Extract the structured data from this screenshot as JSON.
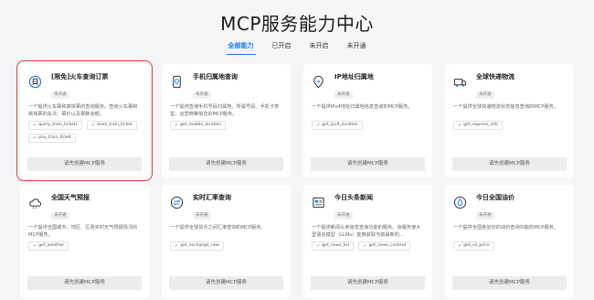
{
  "page": {
    "title": "MCP服务能力中心"
  },
  "tabs": [
    {
      "label": "全部能力",
      "active": true
    },
    {
      "label": "已开启"
    },
    {
      "label": "未开启"
    },
    {
      "label": "未开通"
    }
  ],
  "cards": [
    {
      "name": "[限免]火车查询订票",
      "status": "未开通",
      "desc": "一个提供火车票和高铁票的查询服务。查询火车票和高铁票的车次、票价以及票数余额。",
      "tags": [
        "query_train_tickets",
        "book_train_ticket",
        "pay_train_ticket"
      ],
      "button": "请先创建MCP服务",
      "icon": "train-icon"
    },
    {
      "name": "手机归属地查询",
      "status": "未开通",
      "desc": "一个提供查询手机号码归属地、所属号段、手机卡类型、运营商等信息的MCP服务。",
      "tags": [
        "get_mobile_location"
      ],
      "button": "请先创建MCP服务",
      "icon": "phone-location-icon"
    },
    {
      "name": "IP地址归属地",
      "status": "未开通",
      "desc": "一个提供IPv4地址归属地信息查询的MCP服务。",
      "tags": [
        "get_ipv4_location"
      ],
      "button": "请先创建MCP服务",
      "icon": "ip-location-icon"
    },
    {
      "name": "全球快递物流",
      "status": "未开通",
      "desc": "一个提供全球快递物流状态信息查询的MCP服务。",
      "tags": [
        "get_express_info"
      ],
      "button": "请先创建MCP服务",
      "icon": "express-icon"
    },
    {
      "name": "全国天气预报",
      "status": "未开通",
      "desc": "一个提供全国城市、地区、区县实时天气预报情况的MCP服务。",
      "tags": [
        "get_weather"
      ],
      "button": "请先创建MCP服务",
      "icon": "weather-icon"
    },
    {
      "name": "实时汇率查询",
      "status": "未开通",
      "desc": "一个提供全球货币之间汇率查询的MCP服务。",
      "tags": [
        "get_exchange_rate"
      ],
      "button": "请先创建MCP服务",
      "icon": "exchange-icon"
    },
    {
      "name": "今日头条新闻",
      "status": "未开通",
      "desc": "一个提供新闻头条信息查询功能的服务。该服务使大型语言模型（LLMs）能够获取当前最新的...",
      "tags": [
        "get_news_list",
        "get_news_content"
      ],
      "button": "请先创建MCP服务",
      "icon": "news-icon"
    },
    {
      "name": "今日全国油价",
      "status": "未开通",
      "desc": "一个提供全国各省份的油价查询功能的MCP服务。",
      "tags": [
        "get_oil_price"
      ],
      "button": "请先创建MCP服务",
      "icon": "oil-price-icon"
    }
  ]
}
